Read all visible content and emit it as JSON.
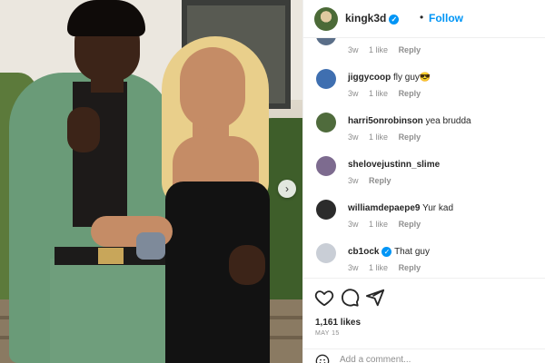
{
  "post": {
    "author": "kingk3d",
    "follow_label": "Follow",
    "separator": "•"
  },
  "comments": [
    {
      "username": "",
      "text": "",
      "time": "3w",
      "likes": "1 like",
      "reply": "Reply",
      "avatar_color": "#5a6e88"
    },
    {
      "username": "jiggycoop",
      "text": "fly guy😎",
      "time": "3w",
      "likes": "1 like",
      "reply": "Reply",
      "avatar_color": "#3f6fb0"
    },
    {
      "username": "harri5onrobinson",
      "text": "yea brudda",
      "time": "3w",
      "likes": "1 like",
      "reply": "Reply",
      "avatar_color": "#4f6b3c"
    },
    {
      "username": "shelovejustinn_slime",
      "text": "",
      "time": "3w",
      "likes": "",
      "reply": "Reply",
      "avatar_color": "#7d6b8f"
    },
    {
      "username": "williamdepaepe9",
      "text": "Yur kad",
      "time": "3w",
      "likes": "1 like",
      "reply": "Reply",
      "avatar_color": "#2b2b2b"
    },
    {
      "username": "cb1ock",
      "text": "That guy",
      "time": "3w",
      "likes": "1 like",
      "reply": "Reply",
      "avatar_color": "#c9ced6",
      "verified": true
    }
  ],
  "actions": {
    "like_icon": "heart-icon",
    "comment_icon": "comment-icon",
    "share_icon": "share-icon"
  },
  "likes_text": "1,161 likes",
  "date_text": "MAY 15",
  "add_comment_placeholder": "Add a comment...",
  "colors": {
    "accent": "#0095f6",
    "muted": "#8e8e8e"
  }
}
